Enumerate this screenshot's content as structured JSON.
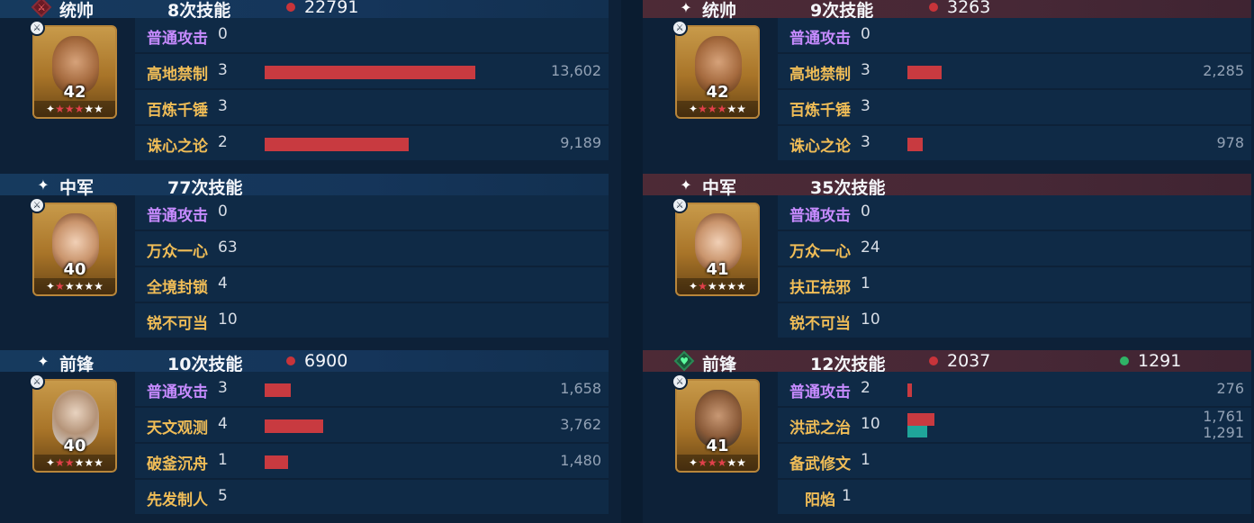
{
  "left": {
    "groups": [
      {
        "role": "统帅",
        "skill_count": "8次技能",
        "damage": "22791",
        "heal": null,
        "header_icon": "sword-diamond-icon",
        "level": "42",
        "stars": {
          "red": 3,
          "total": 5
        },
        "portrait": "warrior",
        "skills": [
          {
            "name": "普通攻击",
            "count": "0",
            "damage": null,
            "damage_fraction": 0,
            "type": "attack"
          },
          {
            "name": "高地禁制",
            "count": "3",
            "damage": "13,602",
            "damage_fraction": 0.44
          },
          {
            "name": "百炼千锤",
            "count": "3",
            "damage": null,
            "damage_fraction": 0
          },
          {
            "name": "诛心之论",
            "count": "2",
            "damage": "9,189",
            "damage_fraction": 0.3
          }
        ]
      },
      {
        "role": "中军",
        "skill_count": "77次技能",
        "damage": null,
        "heal": null,
        "header_icon": "star-icon",
        "level": "40",
        "stars": {
          "red": 1,
          "total": 5
        },
        "portrait": "girl",
        "skills": [
          {
            "name": "普通攻击",
            "count": "0",
            "damage": null,
            "damage_fraction": 0,
            "type": "attack"
          },
          {
            "name": "万众一心",
            "count": "63",
            "damage": null,
            "damage_fraction": 0
          },
          {
            "name": "全境封锁",
            "count": "4",
            "damage": null,
            "damage_fraction": 0
          },
          {
            "name": "锐不可当",
            "count": "10",
            "damage": null,
            "damage_fraction": 0
          }
        ]
      },
      {
        "role": "前锋",
        "skill_count": "10次技能",
        "damage": "6900",
        "heal": null,
        "header_icon": "star-icon",
        "level": "40",
        "stars": {
          "red": 2,
          "total": 5
        },
        "portrait": "sage",
        "skills": [
          {
            "name": "普通攻击",
            "count": "3",
            "damage": "1,658",
            "damage_fraction": 0.055,
            "type": "attack"
          },
          {
            "name": "天文观测",
            "count": "4",
            "damage": "3,762",
            "damage_fraction": 0.123
          },
          {
            "name": "破釜沉舟",
            "count": "1",
            "damage": "1,480",
            "damage_fraction": 0.048
          },
          {
            "name": "先发制人",
            "count": "5",
            "damage": null,
            "damage_fraction": 0
          }
        ]
      }
    ]
  },
  "right": {
    "groups": [
      {
        "role": "统帅",
        "skill_count": "9次技能",
        "damage": "3263",
        "heal": null,
        "header_icon": "star-icon",
        "level": "42",
        "stars": {
          "red": 3,
          "total": 5
        },
        "portrait": "warrior",
        "skills": [
          {
            "name": "普通攻击",
            "count": "0",
            "damage": null,
            "damage_fraction": 0,
            "type": "attack"
          },
          {
            "name": "高地禁制",
            "count": "3",
            "damage": "2,285",
            "damage_fraction": 0.072
          },
          {
            "name": "百炼千锤",
            "count": "3",
            "damage": null,
            "damage_fraction": 0
          },
          {
            "name": "诛心之论",
            "count": "3",
            "damage": "978",
            "damage_fraction": 0.032
          }
        ]
      },
      {
        "role": "中军",
        "skill_count": "35次技能",
        "damage": null,
        "heal": null,
        "header_icon": "star-icon",
        "level": "41",
        "stars": {
          "red": 1,
          "total": 5
        },
        "portrait": "girl",
        "skills": [
          {
            "name": "普通攻击",
            "count": "0",
            "damage": null,
            "damage_fraction": 0,
            "type": "attack"
          },
          {
            "name": "万众一心",
            "count": "24",
            "damage": null,
            "damage_fraction": 0
          },
          {
            "name": "扶正祛邪",
            "count": "1",
            "damage": null,
            "damage_fraction": 0
          },
          {
            "name": "锐不可当",
            "count": "10",
            "damage": null,
            "damage_fraction": 0
          }
        ]
      },
      {
        "role": "前锋",
        "skill_count": "12次技能",
        "damage": "2037",
        "heal": "1291",
        "header_icon": "heart-diamond-icon",
        "level": "41",
        "stars": {
          "red": 3,
          "total": 5
        },
        "portrait": "soldier",
        "skills": [
          {
            "name": "普通攻击",
            "count": "2",
            "damage": "276",
            "damage_fraction": 0.009,
            "type": "attack"
          },
          {
            "name": "洪武之治",
            "count": "10",
            "damage": "1,761",
            "heal": "1,291",
            "damage_fraction": 0.057,
            "heal_fraction": 0.042
          },
          {
            "name": "备武修文",
            "count": "1",
            "damage": null,
            "damage_fraction": 0
          },
          {
            "name": "阳焰",
            "count": "1",
            "damage": null,
            "damage_fraction": 0,
            "indent": true
          }
        ]
      }
    ]
  }
}
